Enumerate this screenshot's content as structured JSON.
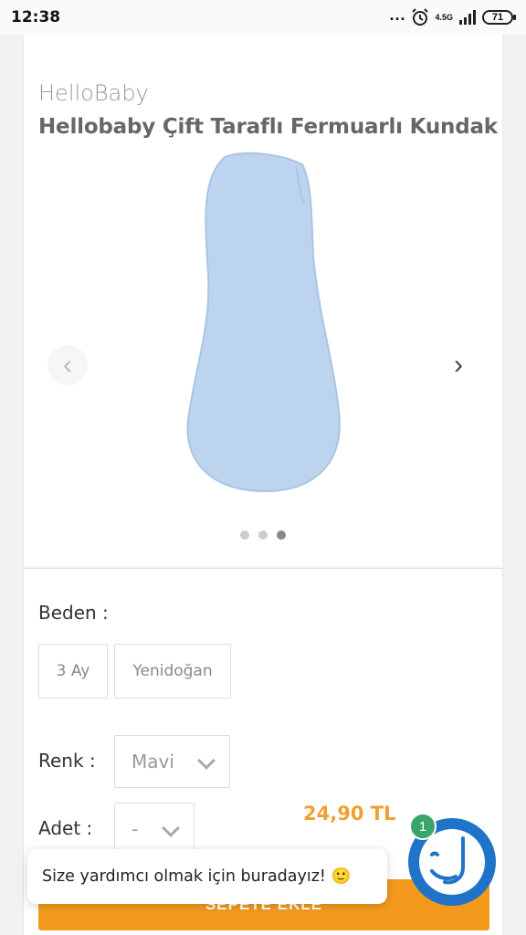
{
  "status_bar": {
    "time": "12:38",
    "dots": "...",
    "network": "4.5G",
    "battery": "71"
  },
  "product": {
    "brand": "HelloBaby",
    "title": "Hellobaby Çift Taraflı Fermuarlı Kundak",
    "image_color": "#bcd4ee",
    "carousel": {
      "prev_icon": "chevron-left-icon",
      "next_icon": "chevron-right-icon",
      "slide_count": 3,
      "active_index": 2
    }
  },
  "options": {
    "size_label": "Beden :",
    "sizes": [
      "3 Ay",
      "Yenidoğan"
    ],
    "color_label": "Renk :",
    "color_value": "Mavi",
    "quantity_label": "Adet :",
    "quantity_value": "-",
    "price": "24,90 TL",
    "add_to_cart": "SEPETE EKLE"
  },
  "chat": {
    "tooltip": "Size yardımcı olmak için buradayız! 🙂",
    "badge_count": "1",
    "accent": "#1f74c9"
  },
  "colors": {
    "price": "#f0a030",
    "cart_button": "#f39a1d",
    "badge": "#3aa56b"
  }
}
